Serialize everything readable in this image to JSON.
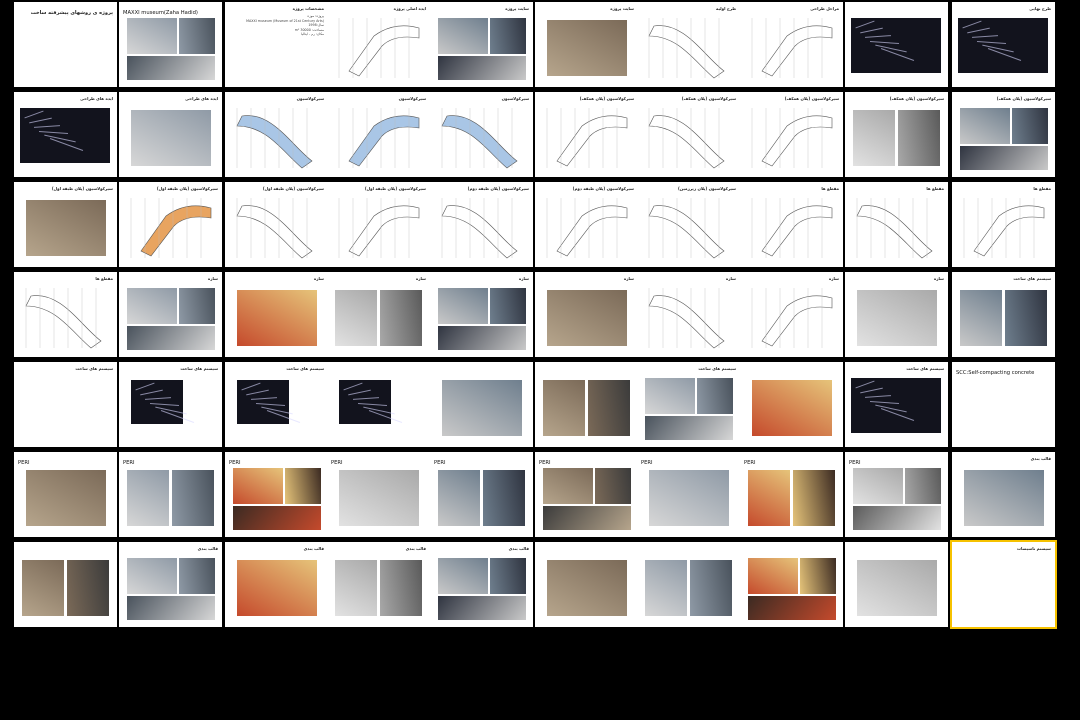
{
  "presentation": {
    "accent_color": "#f6c200",
    "slide_bg": "#ffffff",
    "sorter_bg": "#000000"
  },
  "slides": [
    {
      "id": 1,
      "title": "پروژه ی روشهای پیشرفته ساخت"
    },
    {
      "id": 2,
      "title": "MAXXI museum(Zaha Hadid)"
    },
    {
      "id": 3,
      "title": "مشخصات پروژه",
      "lines": [
        "پروژه: موزه",
        "MAXXI museum (Museum of 21st Century Arts)",
        "سال:1998",
        "مساحت: 30000 m²",
        "مکان: رم - ایتالیا"
      ]
    },
    {
      "id": 4,
      "title": "ایده اصلی پروژه"
    },
    {
      "id": 5,
      "title": "سایت پروژه"
    },
    {
      "id": 6,
      "title": "سایت پروژه"
    },
    {
      "id": 7,
      "title": "طرح اولیه"
    },
    {
      "id": 8,
      "title": "مراحل طراحی"
    },
    {
      "id": 9,
      "title": ""
    },
    {
      "id": 10,
      "title": "طرح نهایی"
    },
    {
      "id": 11,
      "title": "ایده های طراحی"
    },
    {
      "id": 12,
      "title": "ایده های طراحی"
    },
    {
      "id": 13,
      "title": "سیرکولاسیون"
    },
    {
      "id": 14,
      "title": "سیرکولاسیون"
    },
    {
      "id": 15,
      "title": "سیرکولاسیون"
    },
    {
      "id": 16,
      "title": "سیرکولاسیون (پلان همکف)"
    },
    {
      "id": 17,
      "title": "سیرکولاسیون (پلان همکف)"
    },
    {
      "id": 18,
      "title": "سیرکولاسیون (پلان همکف)"
    },
    {
      "id": 19,
      "title": "سیرکولاسیون (پلان همکف)"
    },
    {
      "id": 20,
      "title": "سیرکولاسیون (پلان همکف)"
    },
    {
      "id": 21,
      "title": "سیرکولاسیون (پلان طبقه اول)"
    },
    {
      "id": 22,
      "title": "سیرکولاسیون (پلان طبقه اول)"
    },
    {
      "id": 23,
      "title": "سیرکولاسیون (پلان طبقه اول)"
    },
    {
      "id": 24,
      "title": "سیرکولاسیون (پلان طبقه اول)"
    },
    {
      "id": 25,
      "title": "سیرکولاسیون (پلان طبقه دوم)"
    },
    {
      "id": 26,
      "title": "سیرکولاسیون (پلان طبقه دوم)"
    },
    {
      "id": 27,
      "title": "سیرکولاسیون (پلان زیرزمین)"
    },
    {
      "id": 28,
      "title": "مقطع ها"
    },
    {
      "id": 29,
      "title": "مقطع ها"
    },
    {
      "id": 30,
      "title": "مقطع ها"
    },
    {
      "id": 31,
      "title": "مقطع ها"
    },
    {
      "id": 32,
      "title": "سازه"
    },
    {
      "id": 33,
      "title": "سازه"
    },
    {
      "id": 34,
      "title": "سازه"
    },
    {
      "id": 35,
      "title": "سازه"
    },
    {
      "id": 36,
      "title": "سازه"
    },
    {
      "id": 37,
      "title": "سازه"
    },
    {
      "id": 38,
      "title": "سازه"
    },
    {
      "id": 39,
      "title": "سازه"
    },
    {
      "id": 40,
      "title": "سیستم های ساخت"
    },
    {
      "id": 41,
      "title": "سیستم های ساخت"
    },
    {
      "id": 42,
      "title": "سیستم های ساخت"
    },
    {
      "id": 43,
      "title": "سیستم های ساخت"
    },
    {
      "id": 44,
      "title": ""
    },
    {
      "id": 45,
      "title": ""
    },
    {
      "id": 46,
      "title": ""
    },
    {
      "id": 47,
      "title": "سیستم های ساخت"
    },
    {
      "id": 48,
      "title": ""
    },
    {
      "id": 49,
      "title": "سیستم های ساخت"
    },
    {
      "id": 50,
      "title": "SCC:Self-compacting concrete"
    },
    {
      "id": 51,
      "title": "PERI"
    },
    {
      "id": 52,
      "title": "PERI"
    },
    {
      "id": 53,
      "title": "PERI"
    },
    {
      "id": 54,
      "title": "PERI"
    },
    {
      "id": 55,
      "title": "PERI"
    },
    {
      "id": 56,
      "title": "PERI"
    },
    {
      "id": 57,
      "title": "PERI"
    },
    {
      "id": 58,
      "title": "PERI"
    },
    {
      "id": 59,
      "title": "PERI"
    },
    {
      "id": 60,
      "title": "قالب بندی"
    },
    {
      "id": 61,
      "title": ""
    },
    {
      "id": 62,
      "title": "قالب بندی"
    },
    {
      "id": 63,
      "title": "قالب بندی"
    },
    {
      "id": 64,
      "title": "قالب بندی"
    },
    {
      "id": 65,
      "title": "قالب بندی"
    },
    {
      "id": 66,
      "title": ""
    },
    {
      "id": 67,
      "title": ""
    },
    {
      "id": 68,
      "title": ""
    },
    {
      "id": 69,
      "title": ""
    },
    {
      "id": 70,
      "title": "سیستم تاسیسات"
    }
  ]
}
